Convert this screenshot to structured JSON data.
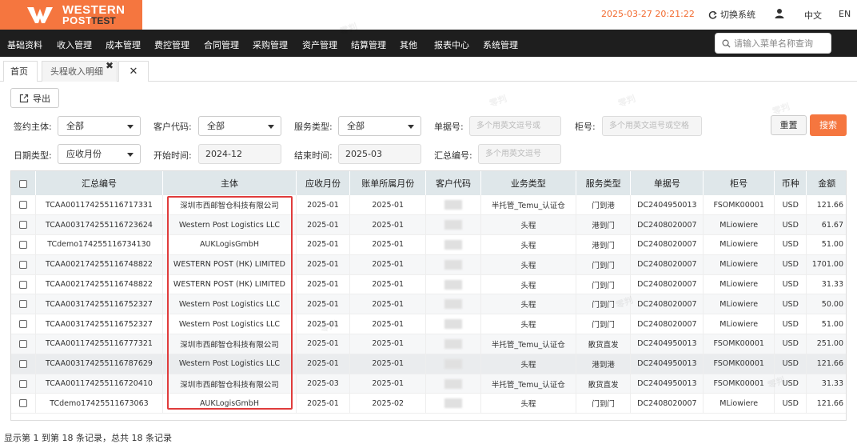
{
  "header": {
    "logo_line1": "WESTERN",
    "logo_line2": "POST",
    "logo_test": "TEST",
    "datetime": "2025-03-27 20:21:22",
    "switch_label": "切换系统",
    "lang_zh": "中文",
    "lang_en": "EN"
  },
  "nav": {
    "items": [
      "基础资料",
      "收入管理",
      "成本管理",
      "费控管理",
      "合同管理",
      "采购管理",
      "资产管理",
      "结算管理",
      "其他",
      "报表中心",
      "系统管理"
    ],
    "search_placeholder": "请输入菜单名称查询"
  },
  "tabs": {
    "home": "首页",
    "active": "头程收入明细",
    "close_symbol": "✖"
  },
  "toolbar": {
    "export_label": "导出"
  },
  "filters": {
    "sign_subject_label": "签约主体:",
    "sign_subject_value": "全部",
    "customer_code_label": "客户代码:",
    "customer_code_value": "全部",
    "service_type_label": "服务类型:",
    "service_type_value": "全部",
    "doc_no_label": "单据号:",
    "doc_no_placeholder": "多个用英文逗号或",
    "container_label": "柜号:",
    "container_placeholder": "多个用英文逗号或空格",
    "date_type_label": "日期类型:",
    "date_type_value": "应收月份",
    "start_label": "开始时间:",
    "start_value": "2024-12",
    "end_label": "结束时间:",
    "end_value": "2025-03",
    "summary_no_label": "汇总编号:",
    "summary_no_placeholder": "多个用英文逗号",
    "reset_label": "重置",
    "search_label": "搜索"
  },
  "table": {
    "columns": [
      "",
      "汇总编号",
      "主体",
      "应收月份",
      "账单所属月份",
      "客户代码",
      "业务类型",
      "服务类型",
      "单据号",
      "柜号",
      "币种",
      "金额"
    ],
    "rows": [
      [
        "TCAA001174255116717331",
        "深圳市西邮智仓科技有限公司",
        "2025-01",
        "2025-01",
        "半托管_Temu_认证仓",
        "门到港",
        "DC2404950013",
        "FSOMK00001",
        "USD",
        "121.66"
      ],
      [
        "TCAA003174255116723624",
        "Western Post Logistics LLC",
        "2025-01",
        "2025-01",
        "头程",
        "港到门",
        "DC2408020007",
        "MLiowiere",
        "USD",
        "61.67"
      ],
      [
        "TCdemo174255116734130",
        "AUKLogisGmbH",
        "2025-01",
        "2025-01",
        "头程",
        "港到门",
        "DC2408020007",
        "MLiowiere",
        "USD",
        "51.00"
      ],
      [
        "TCAA002174255116748822",
        "WESTERN POST (HK) LIMITED",
        "2025-01",
        "2025-01",
        "头程",
        "门到门",
        "DC2408020007",
        "MLiowiere",
        "USD",
        "1701.00"
      ],
      [
        "TCAA002174255116748822",
        "WESTERN POST (HK) LIMITED",
        "2025-01",
        "2025-01",
        "头程",
        "门到门",
        "DC2408020007",
        "MLiowiere",
        "USD",
        "31.33"
      ],
      [
        "TCAA003174255116752327",
        "Western Post Logistics LLC",
        "2025-01",
        "2025-01",
        "头程",
        "门到门",
        "DC2408020007",
        "MLiowiere",
        "USD",
        "50.00"
      ],
      [
        "TCAA003174255116752327",
        "Western Post Logistics LLC",
        "2025-01",
        "2025-01",
        "头程",
        "门到门",
        "DC2408020007",
        "MLiowiere",
        "USD",
        "51.00"
      ],
      [
        "TCAA001174255116777321",
        "深圳市西邮智仓科技有限公司",
        "2025-01",
        "2025-01",
        "半托管_Temu_认证仓",
        "散货直发",
        "DC2404950013",
        "FSOMK00001",
        "USD",
        "251.00"
      ],
      [
        "TCAA003174255116787629",
        "Western Post Logistics LLC",
        "2025-01",
        "2025-01",
        "头程",
        "港到港",
        "DC2404950013",
        "FSOMK00001",
        "USD",
        "121.66"
      ],
      [
        "TCAA001174255116720410",
        "深圳市西邮智仓科技有限公司",
        "2025-03",
        "2025-01",
        "半托管_Temu_认证仓",
        "散货直发",
        "DC2404950013",
        "FSOMK00001",
        "USD",
        "31.33"
      ],
      [
        "TCdemo17425511673063",
        "AUKLogisGmbH",
        "2025-01",
        "2025-02",
        "头程",
        "门到门",
        "DC2408020007",
        "MLiowiere",
        "USD",
        "121.66"
      ]
    ]
  },
  "footer": {
    "summary": "显示第 1 到第 18 条记录，总共 18 条记录"
  },
  "watermark": "零判",
  "colors": {
    "brand": "#f5763f",
    "nav_bg": "#1e1e1e",
    "header_bg": "#dfe7ea",
    "highlight": "#e03c3c"
  }
}
